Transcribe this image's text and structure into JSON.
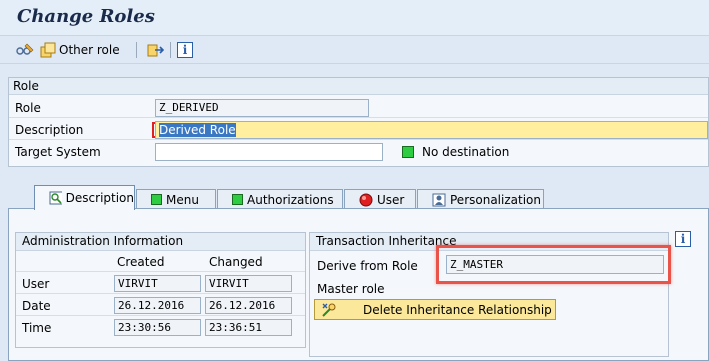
{
  "title": "Change Roles",
  "toolbar": {
    "other_role_label": "Other role"
  },
  "role_panel": {
    "header": "Role",
    "role_label": "Role",
    "role_value": "Z_DERIVED",
    "description_label": "Description",
    "description_value": "Derived Role",
    "target_system_label": "Target System",
    "target_system_value": "",
    "destination_status": "No destination"
  },
  "tabs": [
    {
      "label": "Description",
      "icon": "description-icon"
    },
    {
      "label": "Menu",
      "icon": "green-status-icon"
    },
    {
      "label": "Authorizations",
      "icon": "green-status-icon"
    },
    {
      "label": "User",
      "icon": "red-status-icon"
    },
    {
      "label": "Personalization",
      "icon": "personalization-icon"
    }
  ],
  "admin_info": {
    "header": "Administration Information",
    "col_created": "Created",
    "col_changed": "Changed",
    "rows": [
      {
        "label": "User",
        "created": "VIRVIT",
        "changed": "VIRVIT"
      },
      {
        "label": "Date",
        "created": "26.12.2016",
        "changed": "26.12.2016"
      },
      {
        "label": "Time",
        "created": "23:30:56",
        "changed": "23:36:51"
      }
    ]
  },
  "inheritance": {
    "header": "Transaction Inheritance",
    "derive_label": "Derive from Role",
    "derive_value": "Z_MASTER",
    "master_label": "Master role",
    "delete_button": "Delete Inheritance Relationship"
  },
  "colors": {
    "highlight": "#e8534a",
    "green_status": "#2ecc40",
    "red_status": "#e02020",
    "button_yellow": "#fbe89a"
  }
}
